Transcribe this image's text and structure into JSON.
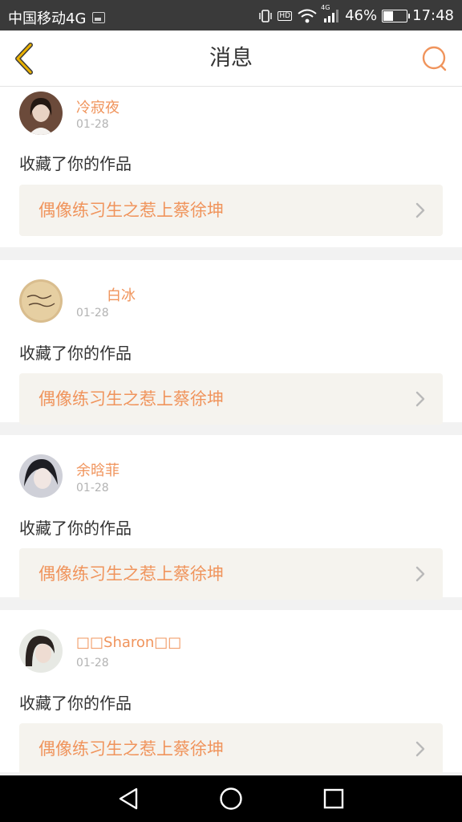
{
  "status_bar": {
    "carrier": "中国移动4G",
    "network_label": "4G",
    "battery_percent": "46%",
    "battery_level": 0.46,
    "time": "17:48",
    "hd_label": "HD"
  },
  "header": {
    "title": "消息",
    "back_icon": "chevron-left-icon",
    "search_icon": "search-icon"
  },
  "colors": {
    "accent": "#f0945c",
    "back_icon": "#e9b000",
    "card_bg": "#f5f3ee"
  },
  "messages": [
    {
      "user": "冷寂夜",
      "date": "01-28",
      "action": "收藏了你的作品",
      "work_title": "偶像练习生之惹上蔡徐坤"
    },
    {
      "user": "白冰",
      "date": "01-28",
      "action": "收藏了你的作品",
      "work_title": "偶像练习生之惹上蔡徐坤"
    },
    {
      "user": "余晗菲",
      "date": "01-28",
      "action": "收藏了你的作品",
      "work_title": "偶像练习生之惹上蔡徐坤"
    },
    {
      "user": "□□Sharon□□",
      "date": "01-28",
      "action": "收藏了你的作品",
      "work_title": "偶像练习生之惹上蔡徐坤"
    }
  ],
  "system_nav": {
    "back_icon": "triangle-back-icon",
    "home_icon": "circle-home-icon",
    "recents_icon": "square-recents-icon"
  }
}
